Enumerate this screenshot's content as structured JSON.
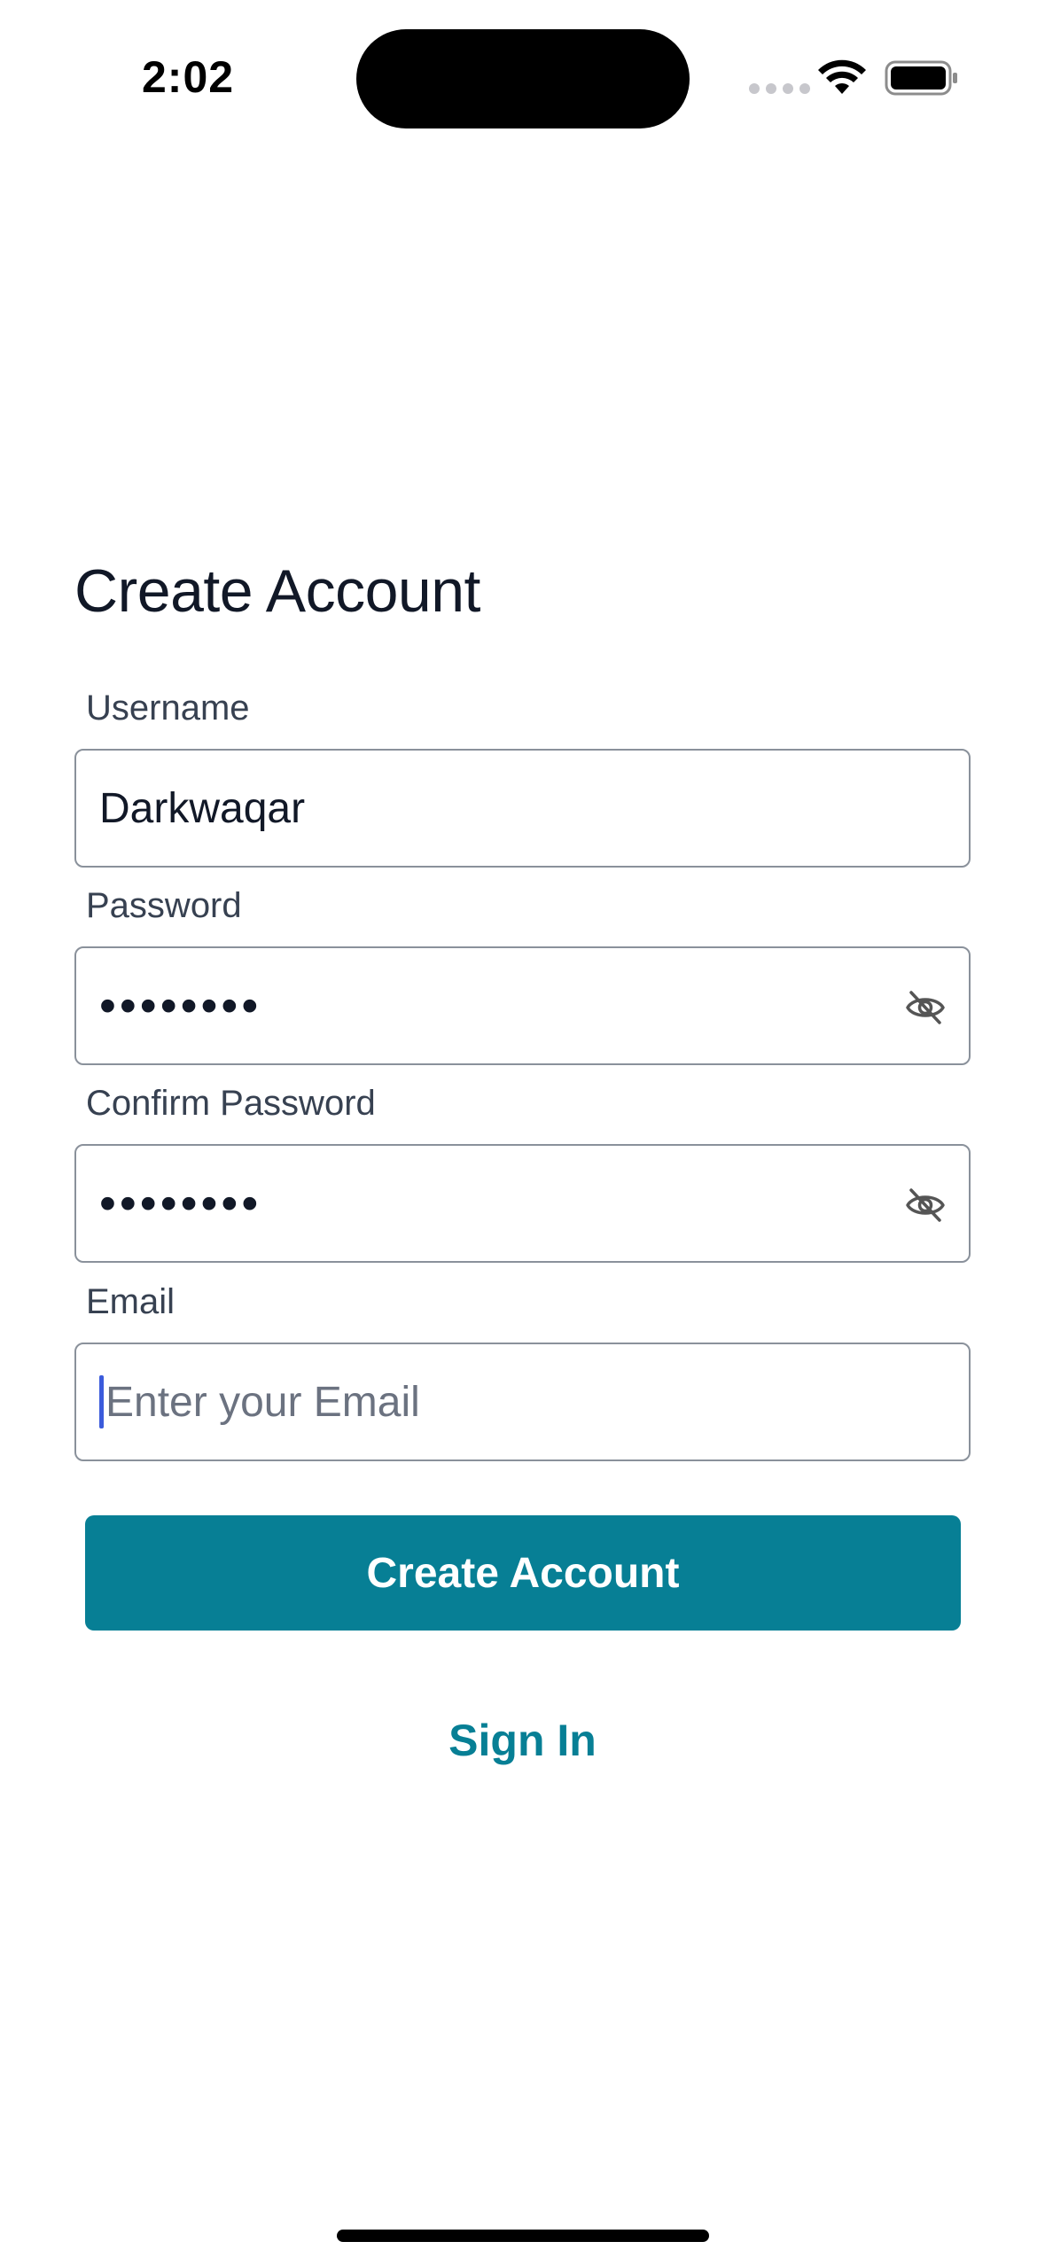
{
  "status_bar": {
    "time": "2:02"
  },
  "page": {
    "title": "Create Account"
  },
  "form": {
    "username": {
      "label": "Username",
      "value": "Darkwaqar"
    },
    "password": {
      "label": "Password",
      "masked_value": "••••••••"
    },
    "confirm_password": {
      "label": "Confirm Password",
      "masked_value": "••••••••"
    },
    "email": {
      "label": "Email",
      "placeholder": "Enter your Email"
    }
  },
  "actions": {
    "create_account_label": "Create Account",
    "sign_in_label": "Sign In"
  },
  "colors": {
    "accent": "#077f95",
    "text": "#111827",
    "border": "#8a919b"
  }
}
